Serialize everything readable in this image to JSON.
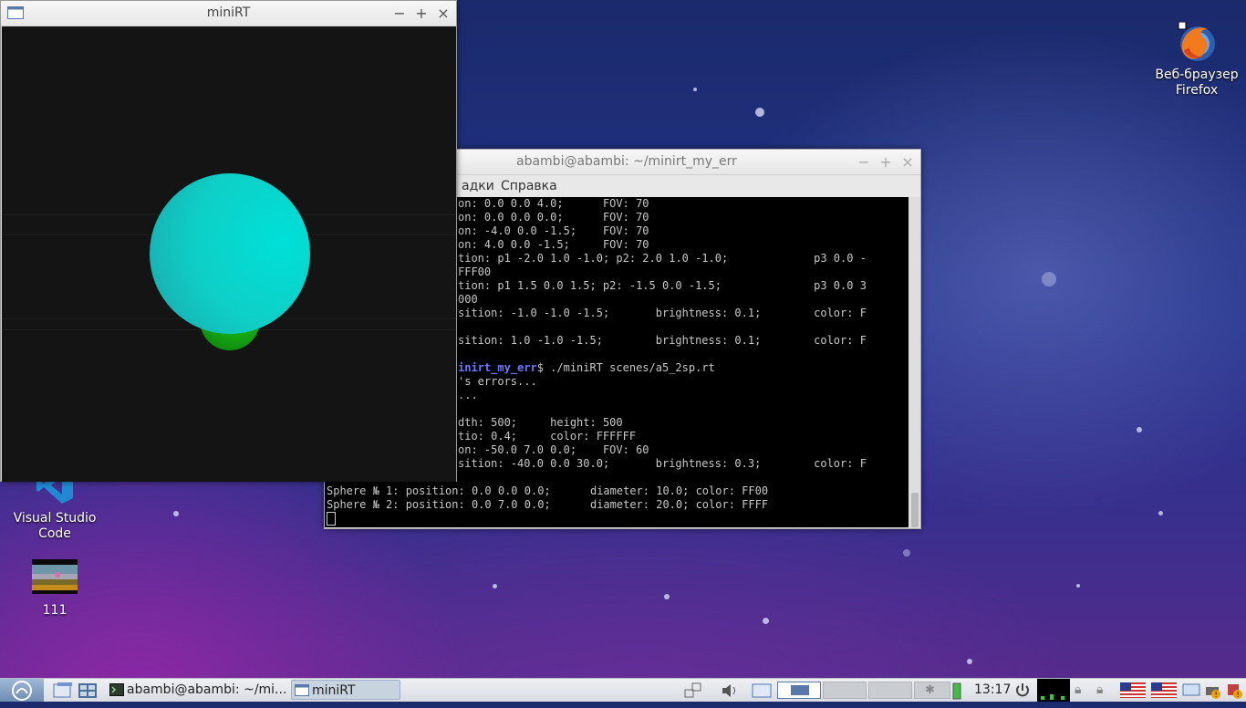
{
  "desktop": {
    "icons": [
      {
        "label_line1": "Веб-браузер",
        "label_line2": "Firefox",
        "icon": "firefox-icon"
      },
      {
        "label_line1": "Visual Studio",
        "label_line2": "Code",
        "icon": "vscode-icon"
      },
      {
        "label_line1": "111",
        "icon": "image-file-icon"
      }
    ]
  },
  "minirt_window": {
    "title": "miniRT",
    "spheres": [
      {
        "color": "#00e0d8",
        "role": "large"
      },
      {
        "color": "#1fd71f",
        "role": "small"
      }
    ]
  },
  "terminal_window": {
    "title": "abambi@abambi: ~/minirt_my_err",
    "menu": [
      "адки",
      "Справка"
    ],
    "lines": [
      "on: 0.0 0.0 4.0;      FOV: 70",
      "on: 0.0 0.0 0.0;      FOV: 70",
      "on: -4.0 0.0 -1.5;    FOV: 70",
      "on: 4.0 0.0 -1.5;     FOV: 70",
      "tion: p1 -2.0 1.0 -1.0; p2: 2.0 1.0 -1.0;             p3 0.0 -",
      "FFF00",
      "tion: p1 1.5 0.0 1.5; p2: -1.5 0.0 -1.5;              p3 0.0 3",
      "000",
      "sition: -1.0 -1.0 -1.5;       brightness: 0.1;        color: F",
      "",
      "sition: 1.0 -1.0 -1.5;        brightness: 0.1;        color: F",
      "",
      "",
      "'s errors...",
      "...",
      "",
      "dth: 500;     height: 500",
      "tio: 0.4;     color: FFFFFF",
      "on: -50.0 7.0 0.0;    FOV: 60",
      "sition: -40.0 0.0 30.0;       brightness: 0.3;        color: F",
      "",
      "Sphere № 1: position: 0.0 0.0 0.0;      diameter: 10.0; color: FF00",
      "Sphere № 2: position: 0.0 7.0 0.0;      diameter: 20.0; color: FFFF"
    ],
    "prompt_dir": "inirt_my_err",
    "prompt_cmd": "$ ./miniRT scenes/a5_2sp.rt"
  },
  "taskbar": {
    "tasks": [
      {
        "label": "abambi@abambi: ~/mi...",
        "icon": "terminal-icon"
      },
      {
        "label": "miniRT",
        "icon": "window-icon"
      }
    ],
    "clock": "13:17"
  }
}
